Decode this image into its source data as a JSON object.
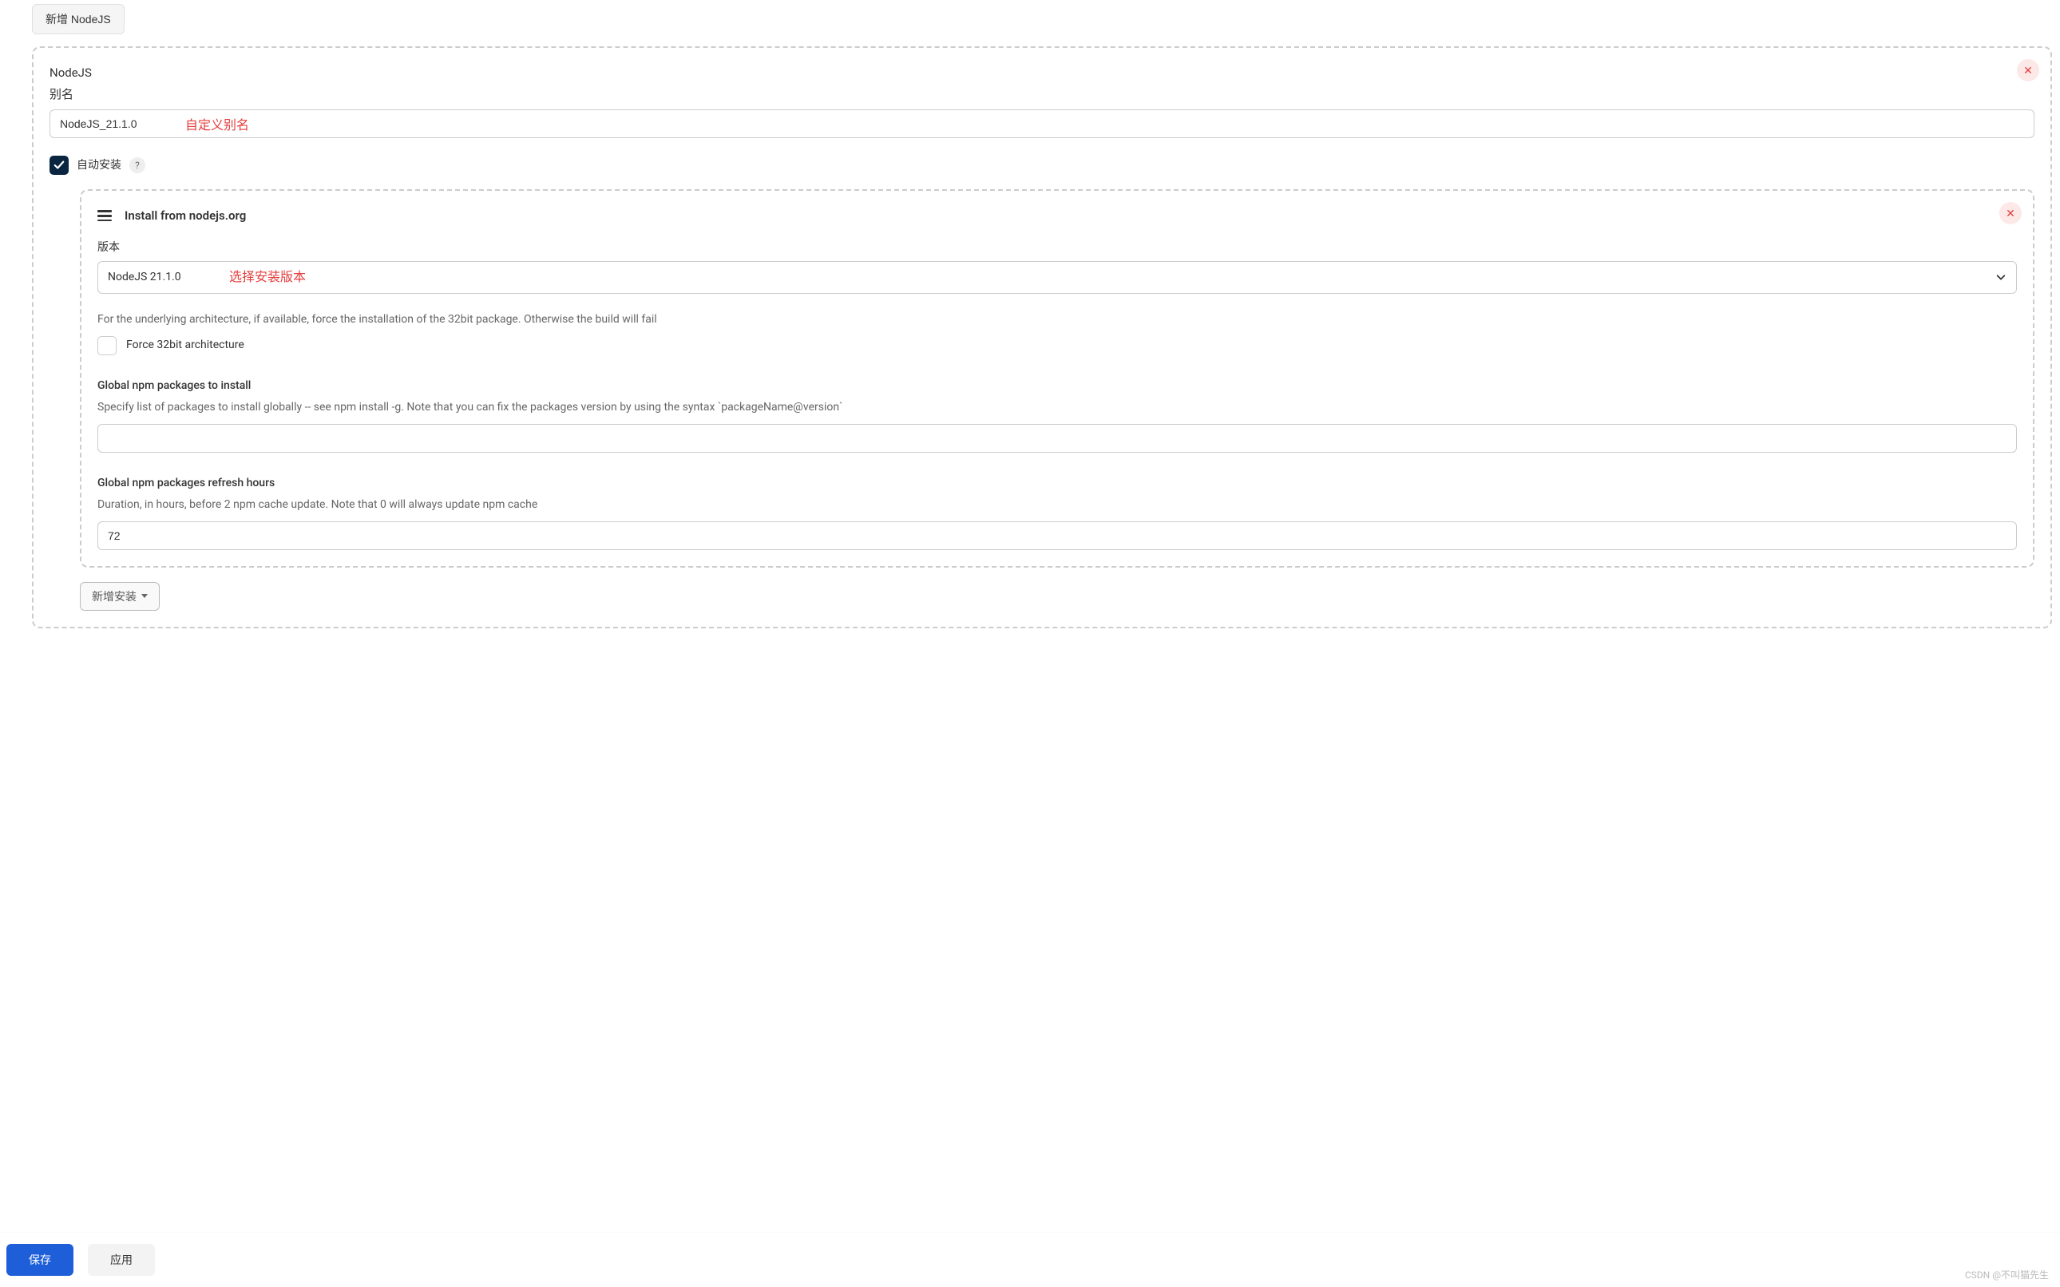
{
  "tab": {
    "addNodejs": "新增 NodeJS"
  },
  "outer": {
    "titleLine1": "NodeJS",
    "titleLine2": "别名",
    "aliasValue": "NodeJS_21.1.0",
    "aliasAnnotation": "自定义别名",
    "autoInstallLabel": "自动安装",
    "helpMark": "?"
  },
  "inner": {
    "title": "Install from nodejs.org",
    "versionLabel": "版本",
    "versionValue": "NodeJS 21.1.0",
    "versionAnnotation": "选择安装版本",
    "archHelp": "For the underlying architecture, if available, force the installation of the 32bit package. Otherwise the build will fail",
    "force32Label": "Force 32bit architecture",
    "globalPkgLabel": "Global npm packages to install",
    "globalPkgDesc": "Specify list of packages to install globally -- see npm install -g. Note that you can fix the packages version by using the syntax `packageName@version`",
    "globalPkgValue": "",
    "refreshLabel": "Global npm packages refresh hours",
    "refreshDesc": "Duration, in hours, before 2 npm cache update. Note that 0 will always update npm cache",
    "refreshValue": "72"
  },
  "addInstaller": "新增安装",
  "footer": {
    "save": "保存",
    "apply": "应用"
  },
  "watermark": "CSDN @不叫猫先生"
}
